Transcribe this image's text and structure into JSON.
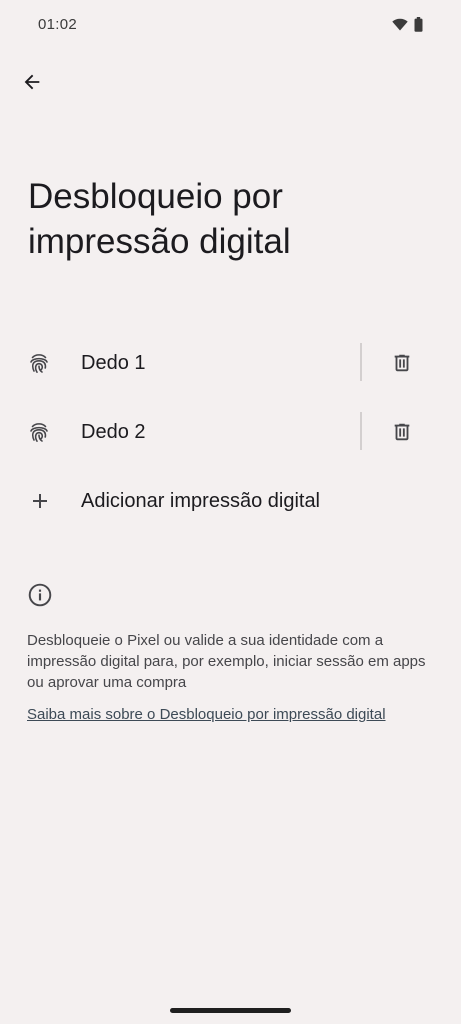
{
  "status_bar": {
    "time": "01:02",
    "icons": [
      "wifi-icon",
      "battery-icon"
    ]
  },
  "header": {
    "back_icon": "arrow-back-icon",
    "title": "Desbloqueio por impressão digital"
  },
  "fingerprints": [
    {
      "label": "Dedo 1",
      "icon": "fingerprint-icon",
      "delete_icon": "trash-icon"
    },
    {
      "label": "Dedo 2",
      "icon": "fingerprint-icon",
      "delete_icon": "trash-icon"
    }
  ],
  "add_fingerprint": {
    "icon": "plus-icon",
    "label": "Adicionar impressão digital"
  },
  "info": {
    "icon": "info-icon",
    "text": "Desbloqueie o Pixel ou valide a sua identidade com a impressão digital para, por exemplo, iniciar sessão em apps ou aprovar uma compra",
    "link": "Saiba mais sobre o Desbloqueio por impressão digital"
  },
  "colors": {
    "background": "#f4f0f0",
    "text_primary": "#1c1b1f",
    "text_secondary": "#46464a",
    "divider": "#d3cfcf"
  }
}
